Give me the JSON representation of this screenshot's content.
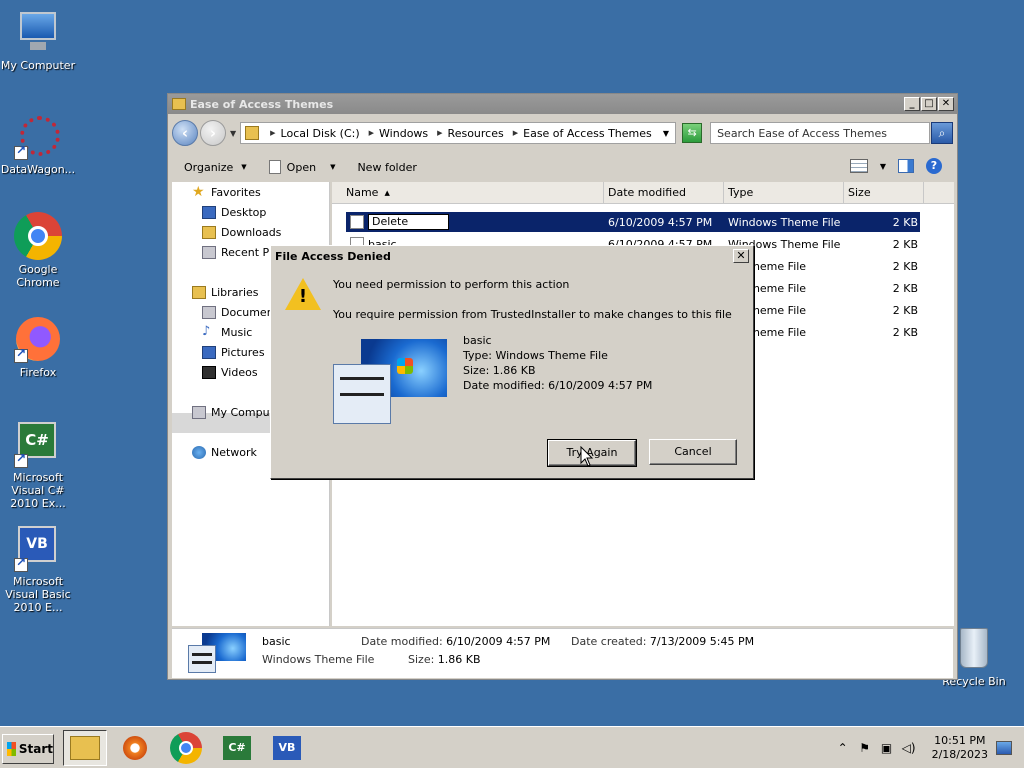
{
  "desktop": {
    "icons": [
      {
        "label": "My Computer",
        "icon": "my-computer-icon"
      },
      {
        "label": "DataWagon...",
        "icon": "datawagon-icon"
      },
      {
        "label": "Google Chrome",
        "icon": "chrome-icon"
      },
      {
        "label": "Firefox",
        "icon": "firefox-icon"
      },
      {
        "label": "Microsoft Visual C# 2010 Ex...",
        "icon": "visual-csharp-icon"
      },
      {
        "label": "Microsoft Visual Basic 2010 E...",
        "icon": "visual-basic-icon"
      },
      {
        "label": "Recycle Bin",
        "icon": "recycle-bin-icon"
      }
    ],
    "csharp_glyph": "C#",
    "vb_glyph": "VB"
  },
  "explorer": {
    "title": "Ease of Access Themes",
    "window_buttons": {
      "minimize": "_",
      "maximize": "□",
      "close": "✕"
    },
    "breadcrumbs": [
      "Local Disk (C:)",
      "Windows",
      "Resources",
      "Ease of Access Themes"
    ],
    "search_placeholder": "Search Ease of Access Themes",
    "commands": {
      "organize": "Organize",
      "open": "Open",
      "new_folder": "New folder"
    },
    "nav": {
      "favorites": "Favorites",
      "desktop": "Desktop",
      "downloads": "Downloads",
      "recent": "Recent Pla",
      "libraries": "Libraries",
      "documents": "Document",
      "music": "Music",
      "pictures": "Pictures",
      "videos": "Videos",
      "computer": "My Compute",
      "network": "Network"
    },
    "columns": {
      "name": "Name",
      "date": "Date modified",
      "type": "Type",
      "size": "Size"
    },
    "files": [
      {
        "name": "Delete",
        "date": "6/10/2009 4:57 PM",
        "type": "Windows Theme File",
        "size": "2 KB"
      },
      {
        "name": "basic",
        "date": "6/10/2009 4:57 PM",
        "type": "Windows Theme File",
        "size": "2 KB"
      },
      {
        "name": "",
        "date": "",
        "type": "ws Theme File",
        "size": "2 KB"
      },
      {
        "name": "",
        "date": "",
        "type": "ws Theme File",
        "size": "2 KB"
      },
      {
        "name": "",
        "date": "",
        "type": "ws Theme File",
        "size": "2 KB"
      },
      {
        "name": "",
        "date": "",
        "type": "ws Theme File",
        "size": "2 KB"
      }
    ],
    "details": {
      "name": "basic",
      "type": "Windows Theme File",
      "date_modified_label": "Date modified:",
      "date_modified": "6/10/2009 4:57 PM",
      "date_created_label": "Date created:",
      "date_created": "7/13/2009 5:45 PM",
      "size_label": "Size:",
      "size": "1.86 KB"
    }
  },
  "dialog": {
    "title": "File Access Denied",
    "close": "✕",
    "heading": "You need permission to perform this action",
    "message": "You require permission from TrustedInstaller to make changes to this file",
    "file_name": "basic",
    "file_type": "Type: Windows Theme File",
    "file_size": "Size: 1.86 KB",
    "file_date": "Date modified: 6/10/2009 4:57 PM",
    "try_again": "Try Again",
    "cancel": "Cancel"
  },
  "taskbar": {
    "start": "Start",
    "time": "10:51 PM",
    "date": "2/18/2023"
  }
}
